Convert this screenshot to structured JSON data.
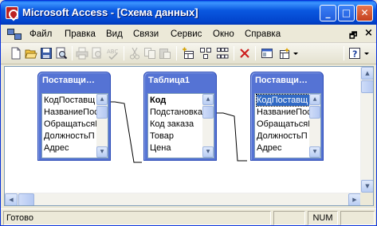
{
  "window": {
    "title": "Microsoft Access - [Схема данных]",
    "controls": {
      "minimize": "_",
      "maximize": "□",
      "close": "✕"
    }
  },
  "menu": {
    "items": [
      "Файл",
      "Правка",
      "Вид",
      "Связи",
      "Сервис",
      "Окно",
      "Справка"
    ],
    "mdi_restore": "🗗",
    "mdi_close": "×"
  },
  "toolbar": {
    "tools": [
      {
        "name": "new-icon",
        "enabled": true
      },
      {
        "name": "open-icon",
        "enabled": true
      },
      {
        "name": "save-icon",
        "enabled": true
      },
      {
        "name": "print-preview-icon",
        "enabled": true
      },
      {
        "name": "print-icon",
        "enabled": false
      },
      {
        "name": "preview-icon",
        "enabled": false
      },
      {
        "name": "spelling-icon",
        "enabled": false
      },
      {
        "name": "cut-icon",
        "enabled": false
      },
      {
        "name": "copy-icon",
        "enabled": false
      },
      {
        "name": "paste-icon",
        "enabled": false
      },
      {
        "name": "show-table-icon",
        "enabled": true
      },
      {
        "name": "show-direct-icon",
        "enabled": true
      },
      {
        "name": "show-all-icon",
        "enabled": true
      },
      {
        "name": "delete-icon",
        "enabled": true
      },
      {
        "name": "database-window-icon",
        "enabled": true
      },
      {
        "name": "new-object-icon",
        "enabled": true
      },
      {
        "name": "help-icon",
        "enabled": true
      }
    ]
  },
  "relationships": {
    "tables": [
      {
        "title": "Поставщи…",
        "fields": [
          "КодПоставщ",
          "НазваниеПос",
          "ОбращатьсяК",
          "ДолжностьП",
          "Адрес"
        ],
        "key_index": -1,
        "selected_index": -1
      },
      {
        "title": "Таблица1",
        "fields": [
          "Код",
          "Подстановка",
          "Код заказа",
          "Товар",
          "Цена"
        ],
        "key_index": 0,
        "selected_index": -1
      },
      {
        "title": "Поставщи…",
        "fields": [
          "КодПоставщ",
          "НазваниеПос",
          "ОбращатьсяК",
          "ДолжностьП",
          "Адрес"
        ],
        "key_index": -1,
        "selected_index": 0
      }
    ]
  },
  "status": {
    "text": "Готово",
    "num": "NUM"
  },
  "colors": {
    "title_bar": "#0a58e0",
    "table_header": "#5573d4",
    "selection": "#316ac5",
    "close_button": "#c4401e"
  }
}
